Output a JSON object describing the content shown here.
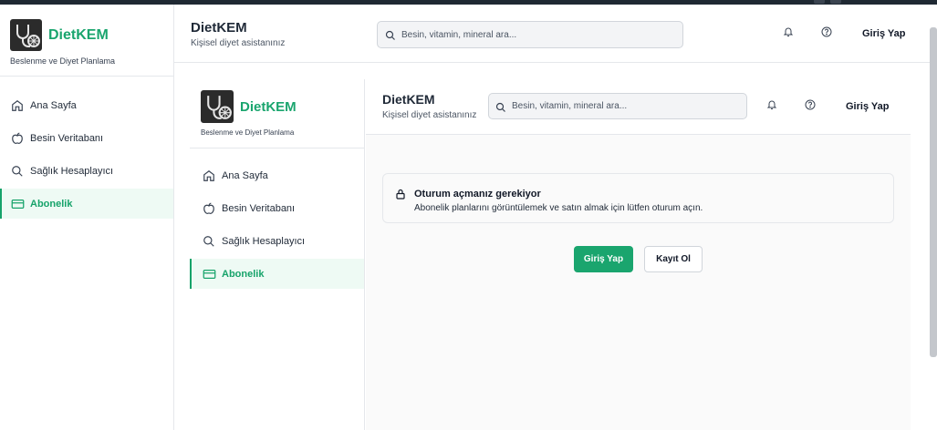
{
  "app": {
    "brand": "DietKEM",
    "tagline": "Beslenme ve Diyet Planlama"
  },
  "header": {
    "title": "DietKEM",
    "subtitle": "Kişisel diyet asistanınız",
    "search_placeholder": "Besin, vitamin, mineral ara...",
    "notification_icon": "bell-icon",
    "help_icon": "question-circle-icon",
    "login_label": "Giriş Yap"
  },
  "sidebar": {
    "items": [
      {
        "label": "Ana Sayfa",
        "icon": "home-icon"
      },
      {
        "label": "Besin Veritabanı",
        "icon": "apple-icon"
      },
      {
        "label": "Sağlık Hesaplayıcı",
        "icon": "search-icon"
      },
      {
        "label": "Abonelik",
        "icon": "credit-card-icon",
        "active": true
      }
    ]
  },
  "embedded": {
    "brand": "DietKEM",
    "tagline": "Beslenme ve Diyet Planlama",
    "header": {
      "title": "DietKEM",
      "subtitle": "Kişisel diyet asistanınız",
      "search_placeholder": "Besin, vitamin, mineral ara...",
      "login_label": "Giriş Yap"
    },
    "sidebar": {
      "items": [
        {
          "label": "Ana Sayfa"
        },
        {
          "label": "Besin Veritabanı"
        },
        {
          "label": "Sağlık Hesaplayıcı"
        },
        {
          "label": "Abonelik",
          "active": true
        }
      ]
    },
    "alert": {
      "icon": "lock-icon",
      "title": "Oturum açmanız gerekiyor",
      "description": "Abonelik planlarını görüntülemek ve satın almak için lütfen oturum açın."
    },
    "actions": {
      "login_label": "Giriş Yap",
      "register_label": "Kayıt Ol"
    }
  },
  "colors": {
    "brand": "#1aa56e",
    "active_bg": "#eefaf4",
    "border": "#e5e7eb"
  }
}
